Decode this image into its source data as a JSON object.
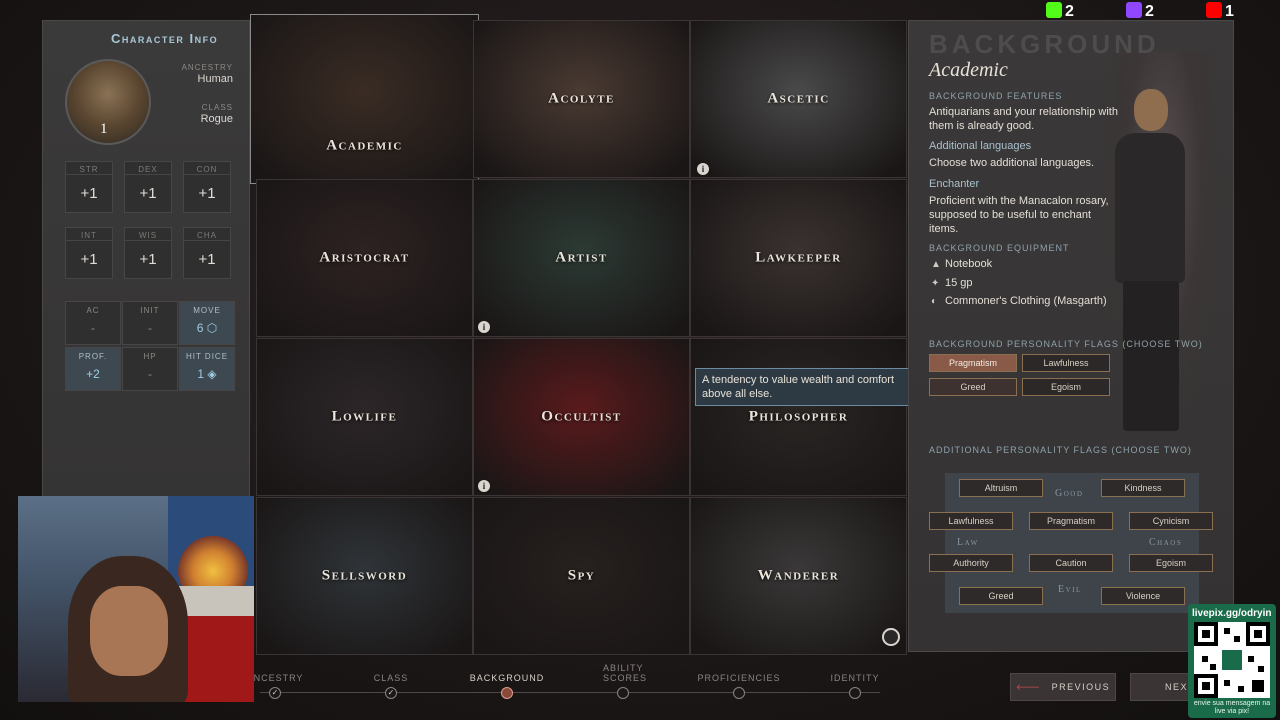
{
  "character": {
    "title": "Character Info",
    "level": "1",
    "ancestry_label": "ANCESTRY",
    "ancestry_value": "Human",
    "class_label": "CLASS",
    "class_value": "Rogue",
    "stats": [
      {
        "label": "STR",
        "value": "+1"
      },
      {
        "label": "DEX",
        "value": "+1"
      },
      {
        "label": "CON",
        "value": "+1"
      },
      {
        "label": "INT",
        "value": "+1"
      },
      {
        "label": "WIS",
        "value": "+1"
      },
      {
        "label": "CHA",
        "value": "+1"
      }
    ],
    "combat": [
      {
        "label": "AC",
        "value": "-"
      },
      {
        "label": "INIT",
        "value": "-"
      },
      {
        "label": "MOVE",
        "value": "6"
      },
      {
        "label": "PROF.",
        "value": "+2"
      },
      {
        "label": "HP",
        "value": "-"
      },
      {
        "label": "HIT DICE",
        "value": "1"
      }
    ]
  },
  "backgrounds": [
    {
      "name": "Academic",
      "selected": true,
      "bg": "#3a2c24"
    },
    {
      "name": "Acolyte",
      "selected": false,
      "bg": "#4a3a32"
    },
    {
      "name": "Ascetic",
      "selected": false,
      "bg": "#4a4a4a"
    },
    {
      "name": "Aristocrat",
      "selected": false,
      "bg": "#2e2222"
    },
    {
      "name": "Artist",
      "selected": false,
      "bg": "#2c3a34"
    },
    {
      "name": "Lawkeeper",
      "selected": false,
      "bg": "#3a3230"
    },
    {
      "name": "Lowlife",
      "selected": false,
      "bg": "#2c2628"
    },
    {
      "name": "Occultist",
      "selected": false,
      "bg": "#5a1a1c"
    },
    {
      "name": "Philosopher",
      "selected": false,
      "bg": "#2a2624"
    },
    {
      "name": "Sellsword",
      "selected": false,
      "bg": "#2f3438"
    },
    {
      "name": "Spy",
      "selected": false,
      "bg": "#26201e"
    },
    {
      "name": "Wanderer",
      "selected": false,
      "bg": "#3a3838"
    }
  ],
  "tooltip": "A tendency to value wealth and comfort above all else.",
  "background_detail": {
    "heading": "BACKGROUND",
    "name": "Academic",
    "features_label": "BACKGROUND FEATURES",
    "feature_1_text": "Antiquarians and your relationship with them is already good.",
    "feature_2_title": "Additional languages",
    "feature_2_text": "Choose two additional languages.",
    "feature_3_title": "Enchanter",
    "feature_3_text": "Proficient with the Manacalon rosary, supposed to be useful to enchant items.",
    "equipment_label": "BACKGROUND EQUIPMENT",
    "equipment": [
      {
        "icon": "backpack-icon",
        "glyph": "▲",
        "text": "Notebook"
      },
      {
        "icon": "coin-icon",
        "glyph": "✦",
        "text": "15 gp"
      },
      {
        "icon": "shirt-icon",
        "glyph": "◐",
        "text": "Commoner's Clothing (Masgarth)"
      }
    ],
    "personality_label": "BACKGROUND PERSONALITY FLAGS (CHOOSE TWO)",
    "personality_flags": [
      {
        "label": "Pragmatism",
        "state": "on"
      },
      {
        "label": "Lawfulness",
        "state": "off"
      },
      {
        "label": "Greed",
        "state": "hover"
      },
      {
        "label": "Egoism",
        "state": "off"
      }
    ],
    "additional_label": "ADDITIONAL PERSONALITY FLAGS (CHOOSE TWO)",
    "alignment": {
      "good": "Good",
      "law": "Law",
      "chaos": "Chaos",
      "evil": "Evil",
      "flags": [
        "Altruism",
        "Kindness",
        "Lawfulness",
        "Pragmatism",
        "Cynicism",
        "Authority",
        "Caution",
        "Egoism",
        "Greed",
        "Violence"
      ]
    }
  },
  "counters": [
    {
      "name": "kick",
      "value": "2",
      "color": "#53fc18"
    },
    {
      "name": "twitch",
      "value": "2",
      "color": "#9146ff"
    },
    {
      "name": "youtube",
      "value": "1",
      "color": "#ff0000"
    }
  ],
  "steps": [
    {
      "label": "ANCESTRY",
      "state": "done"
    },
    {
      "label": "CLASS",
      "state": "done"
    },
    {
      "label": "BACKGROUND",
      "state": "active"
    },
    {
      "label": "ABILITY SCORES",
      "state": "todo"
    },
    {
      "label": "PROFICIENCIES",
      "state": "todo"
    },
    {
      "label": "IDENTITY",
      "state": "todo"
    }
  ],
  "nav": {
    "previous": "PREVIOUS",
    "next": "NEXT"
  },
  "donation": {
    "url": "livepix.gg/odryin",
    "caption": "envie sua mensagem na live via pix!"
  }
}
